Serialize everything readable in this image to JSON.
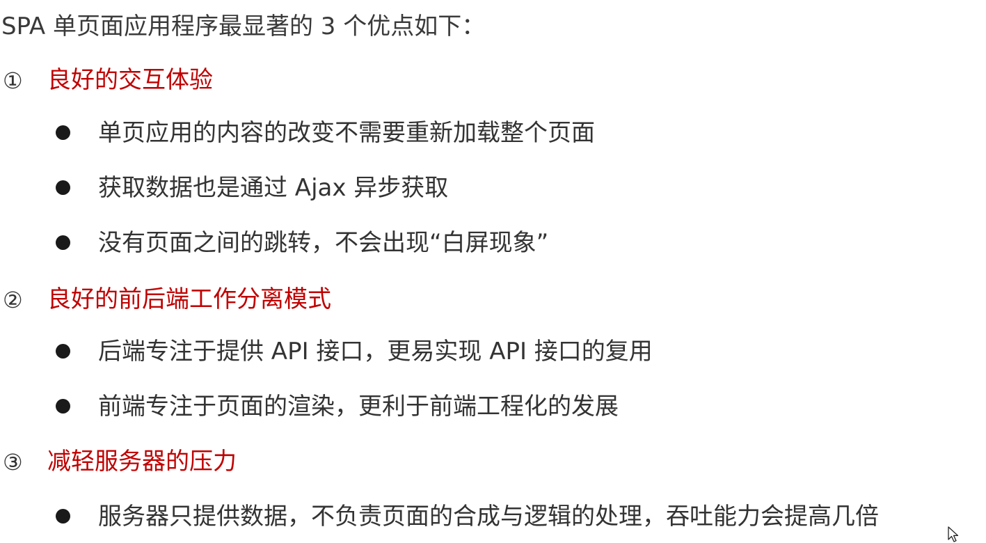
{
  "heading": "SPA 单页面应用程序最显著的 3 个优点如下：",
  "sections": [
    {
      "number": "①",
      "title": "良好的交互体验",
      "items": [
        "单页应用的内容的改变不需要重新加载整个页面",
        "获取数据也是通过 Ajax 异步获取",
        "没有页面之间的跳转，不会出现“白屏现象”"
      ]
    },
    {
      "number": "②",
      "title": "良好的前后端工作分离模式",
      "items": [
        "后端专注于提供 API 接口，更易实现 API 接口的复用",
        "前端专注于页面的渲染，更利于前端工程化的发展"
      ]
    },
    {
      "number": "③",
      "title": "减轻服务器的压力",
      "items": [
        "服务器只提供数据，不负责页面的合成与逻辑的处理，吞吐能力会提高几倍"
      ]
    }
  ],
  "colors": {
    "section_title": "#c00000",
    "body_text": "#333333",
    "bullet": "#1a1a1a"
  },
  "icons": {
    "cursor": "mouse-pointer-icon"
  }
}
